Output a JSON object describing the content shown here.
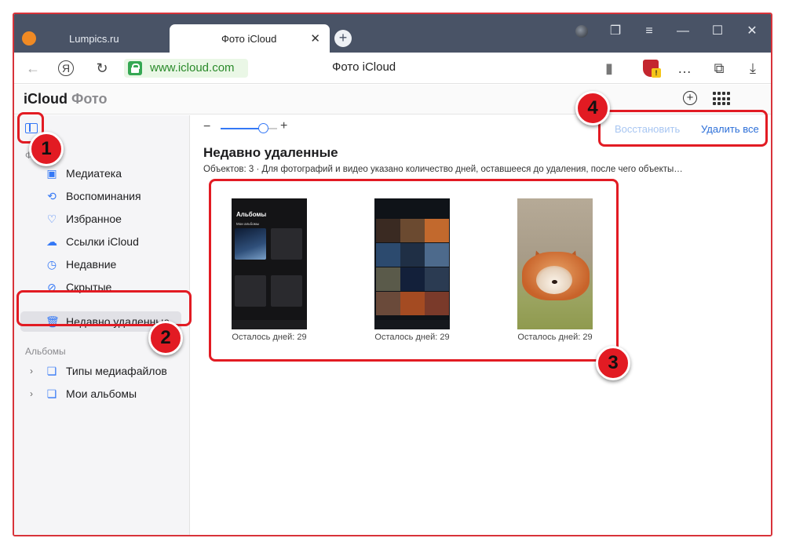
{
  "browser": {
    "tabs": [
      {
        "title": "Lumpics.ru"
      },
      {
        "title": "Фото iCloud"
      }
    ],
    "address_url": "www.icloud.com",
    "page_title": "Фото iCloud"
  },
  "app": {
    "brand_main": "iCloud",
    "brand_sub": "Фото"
  },
  "sidebar": {
    "section_photos": "Фото",
    "items": [
      {
        "label": "Медиатека",
        "icon": "library-icon"
      },
      {
        "label": "Воспоминания",
        "icon": "memories-icon"
      },
      {
        "label": "Избранное",
        "icon": "heart-icon"
      },
      {
        "label": "Ссылки iCloud",
        "icon": "cloud-link-icon"
      },
      {
        "label": "Недавние",
        "icon": "clock-icon"
      },
      {
        "label": "Скрытые",
        "icon": "eye-slash-icon"
      },
      {
        "label": "Недавно удаленные",
        "icon": "trash-icon"
      }
    ],
    "section_albums": "Альбомы",
    "album_items": [
      {
        "label": "Типы медиафайлов"
      },
      {
        "label": "Мои альбомы"
      }
    ]
  },
  "main": {
    "restore_label": "Восстановить",
    "delete_all_label": "Удалить все",
    "title": "Недавно удаленные",
    "meta": "Объектов: 3  ·  Для фотографий и видео указано количество дней, оставшееся до удаления, после чего объекты…",
    "items": [
      {
        "caption": "Осталось дней: 29"
      },
      {
        "caption": "Осталось дней: 29"
      },
      {
        "caption": "Осталось дней: 29"
      }
    ],
    "phone1": {
      "title": "Альбомы",
      "subtitle": "Мои альбомы"
    }
  },
  "callouts": [
    "1",
    "2",
    "3",
    "4"
  ],
  "colors": {
    "accent": "#3478f6",
    "highlight": "#e21b23",
    "tabbar": "#495366",
    "url_green": "#2a8a2a"
  }
}
